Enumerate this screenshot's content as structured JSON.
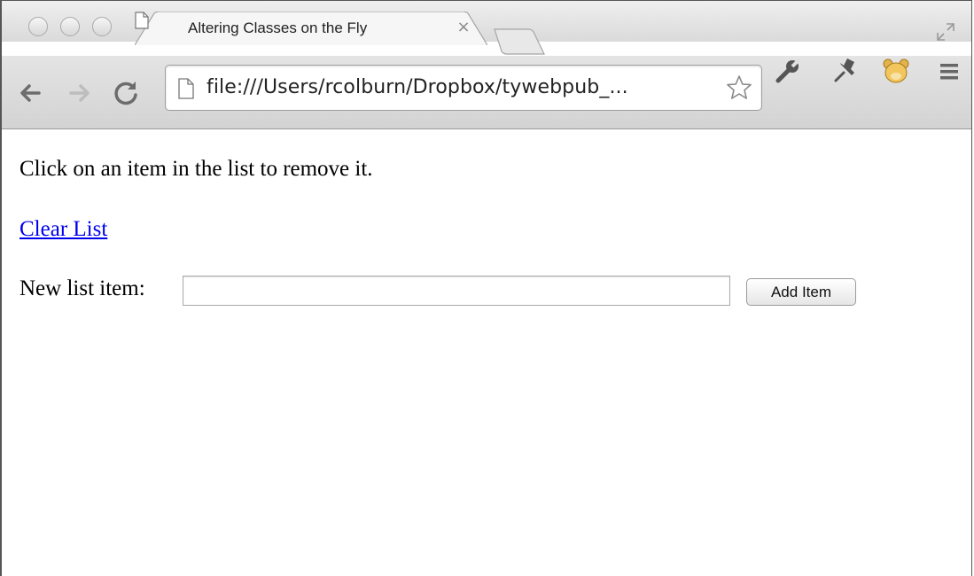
{
  "browser": {
    "tab": {
      "title": "Altering Classes on the Fly",
      "close_glyph": "×"
    },
    "url": "file:///Users/rcolburn/Dropbox/tywebpub_...",
    "icons": {
      "back": "back-arrow-icon",
      "forward": "forward-arrow-icon",
      "reload": "reload-icon",
      "page": "page-icon",
      "star": "star-icon",
      "wrench": "wrench-icon",
      "pin": "pin-icon",
      "extension": "bear-extension-icon",
      "menu": "menu-icon",
      "fullscreen": "fullscreen-icon"
    }
  },
  "page": {
    "instructions": "Click on an item in the list to remove it.",
    "clear_link": "Clear List",
    "new_item_label": "New list item:",
    "new_item_value": "",
    "add_button": "Add Item"
  },
  "colors": {
    "link": "#0000ee",
    "chrome": "#d6d6d6"
  }
}
